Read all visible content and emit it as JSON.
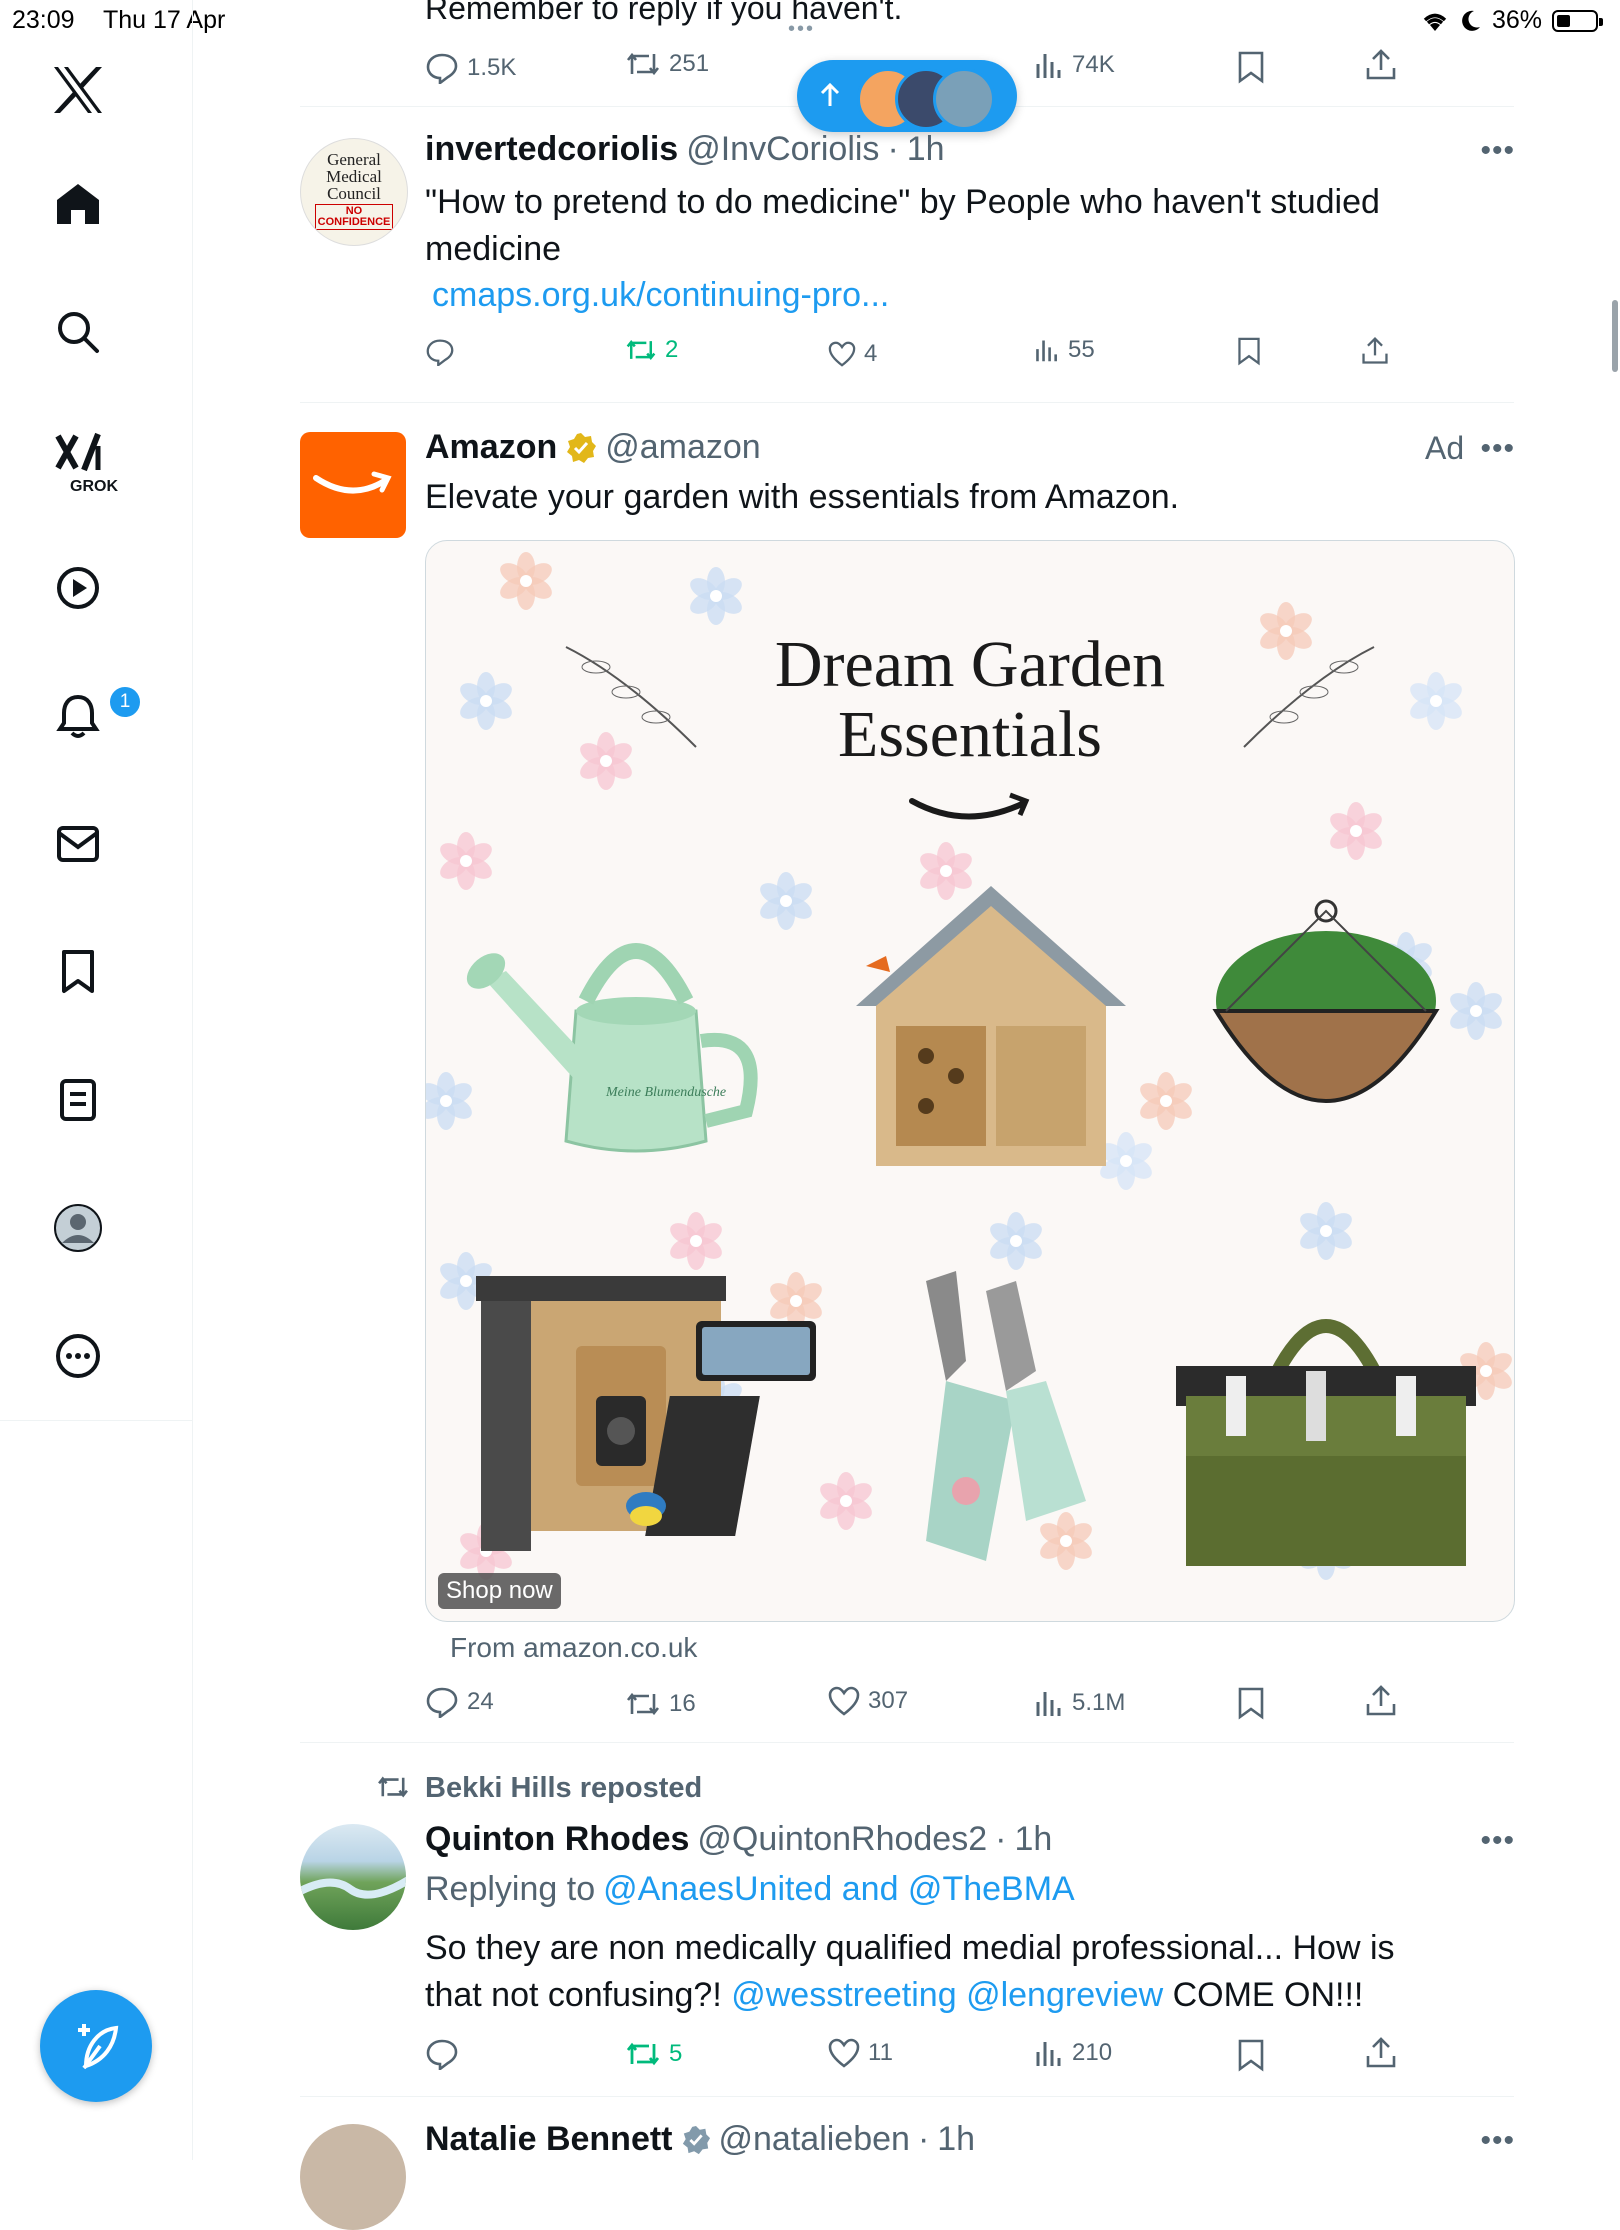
{
  "status_bar": {
    "time": "23:09",
    "date": "Thu 17 Apr",
    "battery": "36%",
    "battery_level": 0.36
  },
  "sidebar": {
    "items": [
      {
        "name": "x-logo",
        "label": "X"
      },
      {
        "name": "home",
        "label": "Home"
      },
      {
        "name": "explore",
        "label": "Explore"
      },
      {
        "name": "grok",
        "label": "GROK"
      },
      {
        "name": "video",
        "label": "Video"
      },
      {
        "name": "notifications",
        "label": "Notifications",
        "badge": "1"
      },
      {
        "name": "messages",
        "label": "Messages"
      },
      {
        "name": "bookmarks",
        "label": "Bookmarks"
      },
      {
        "name": "lists",
        "label": "Lists"
      },
      {
        "name": "profile",
        "label": "Profile"
      },
      {
        "name": "more",
        "label": "More"
      }
    ]
  },
  "feed": {
    "prev_post": {
      "text": "Remember to reply if you haven't.",
      "replies": "1.5K",
      "reposts": "251",
      "views": "74K"
    },
    "post1": {
      "avatar_lines": [
        "General",
        "Medical",
        "Council",
        "NO",
        "CONFIDENCE"
      ],
      "name": "invertedcoriolis",
      "handle": "@InvCoriolis",
      "time": "1h",
      "text": "\"How to pretend to do medicine\" by People who haven't studied medicine",
      "link": "cmaps.org.uk/continuing-pro...",
      "reposts": "2",
      "likes": "4",
      "views": "55"
    },
    "ad": {
      "name": "Amazon",
      "handle": "@amazon",
      "ad_label": "Ad",
      "text": "Elevate your garden with essentials from Amazon.",
      "card_title_1": "Dream Garden",
      "card_title_2": "Essentials",
      "watering_can_text": "Meine Blumendusche",
      "shop_now": "Shop now",
      "from": "From amazon.co.uk",
      "replies": "24",
      "reposts": "16",
      "likes": "307",
      "views": "5.1M"
    },
    "post2": {
      "reposted_by": "Bekki Hills reposted",
      "name": "Quinton Rhodes",
      "handle": "@QuintonRhodes2",
      "time": "1h",
      "replying_prefix": "Replying to",
      "replying_to": "@AnaesUnited and @TheBMA",
      "text_1": "So they are non medically qualified medial professional... How is that not confusing?!",
      "mention_1": "@wesstreeting",
      "mention_2": "@lengreview",
      "text_2": "COME ON!!!",
      "reposts": "5",
      "likes": "11",
      "views": "210"
    },
    "post3": {
      "name": "Natalie Bennett",
      "handle": "@natalieben",
      "time": "1h"
    }
  },
  "colors": {
    "accent": "#1d9bf0",
    "repost_green": "#00ba7c",
    "secondary_text": "#536471",
    "amazon_orange": "#ff6200"
  }
}
